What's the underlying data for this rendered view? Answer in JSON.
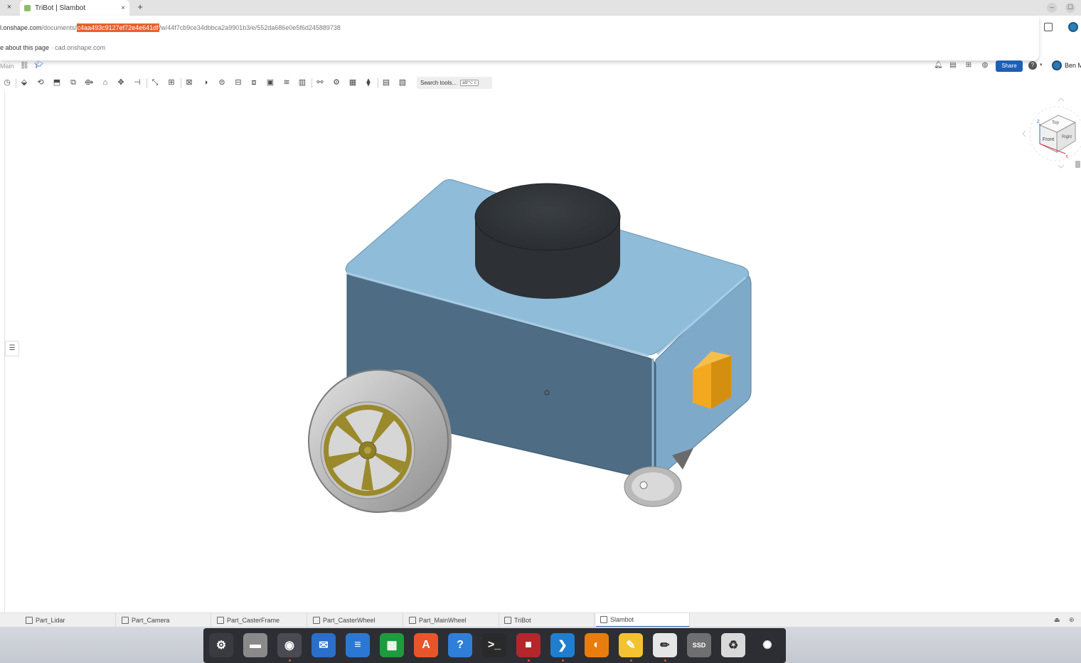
{
  "browser": {
    "tab_title": "TriBot | Slambot",
    "tab_close": "×",
    "new_tab": "+",
    "min_btn": "–",
    "max_btn": "☐"
  },
  "omnibox": {
    "url_host": "l.onshape.com",
    "url_path_prefix": "/documents/",
    "url_selected": "c4aa493c9127ef72e4e641df",
    "url_rest": "/w/44f7cb9ce34dbbca2a9901b3/e/552da686e0e5f6d245889738",
    "about_text": "e about this page",
    "about_sep": " · ",
    "about_domain": "cad.onshape.com"
  },
  "onshape": {
    "branch": "Main",
    "share_label": "Share",
    "user_name": "Ben M",
    "search_tools_label": "Search tools...",
    "search_tools_kbd": "alt/⌥ c"
  },
  "view_cube": {
    "top": "Top",
    "front": "Front",
    "right": "Right",
    "z_axis": "Z",
    "x_axis": "X"
  },
  "part_tabs": [
    {
      "label": "Part_Lidar"
    },
    {
      "label": "Part_Camera"
    },
    {
      "label": "Part_CasterFrame"
    },
    {
      "label": "Part_CasterWheel"
    },
    {
      "label": "Part_MainWheel"
    },
    {
      "label": "TriBot"
    },
    {
      "label": "Slambot",
      "active": true
    }
  ],
  "dock": [
    {
      "name": "settings",
      "icon": "⚙",
      "color": "#3a3b40"
    },
    {
      "name": "files",
      "icon": "▬",
      "color": "#8a8a8a"
    },
    {
      "name": "chrome",
      "icon": "◉",
      "color": "#4a4b52",
      "running": true
    },
    {
      "name": "thunderbird",
      "icon": "✉",
      "color": "#2a6fc9"
    },
    {
      "name": "writer",
      "icon": "≡",
      "color": "#2b78d4"
    },
    {
      "name": "calc",
      "icon": "▦",
      "color": "#1e9b3c"
    },
    {
      "name": "app-center",
      "icon": "A",
      "color": "#e8552b"
    },
    {
      "name": "help",
      "icon": "?",
      "color": "#2f7fd8"
    },
    {
      "name": "terminal",
      "icon": ">_",
      "color": "#2a2a2a"
    },
    {
      "name": "rdp-app",
      "icon": "■",
      "color": "#b3262c",
      "running": true
    },
    {
      "name": "vscode",
      "icon": "❯",
      "color": "#1f7ecf",
      "running": true
    },
    {
      "name": "blender",
      "icon": "◐",
      "color": "#e87d0d"
    },
    {
      "name": "notes",
      "icon": "✎",
      "color": "#f2c230",
      "running": true
    },
    {
      "name": "text-editor",
      "icon": "✏",
      "color": "#e6e6e6",
      "running": true
    },
    {
      "name": "ssd-drive",
      "icon": "SSD",
      "color": "#6f6f72"
    },
    {
      "name": "trash",
      "icon": "♻",
      "color": "#d9d9d9"
    },
    {
      "name": "ubuntu-menu",
      "icon": "✺",
      "color": "#2d2e33"
    }
  ],
  "colors": {
    "body_top": "#8fbcd8",
    "body_front": "#4f6d83",
    "body_side": "#7ea9c8",
    "lidar": "#2e3236",
    "camera": "#f0a81f",
    "rim": "#9a8a2c",
    "tire": "#c8c8c8"
  }
}
